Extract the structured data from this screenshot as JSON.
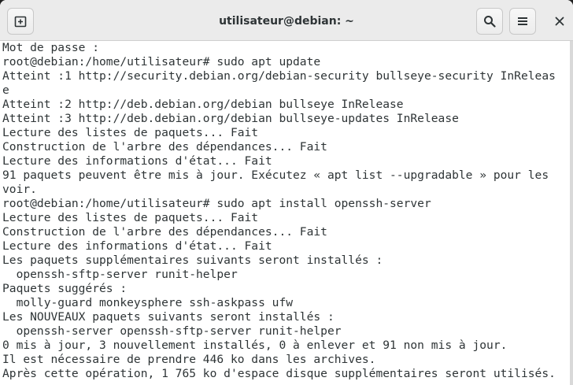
{
  "window": {
    "title": "utilisateur@debian: ~"
  },
  "toolbar": {
    "new_tab_icon": "new-tab-icon",
    "search_icon": "search-icon",
    "menu_icon": "hamburger-menu-icon",
    "close_glyph": "✕"
  },
  "terminal": {
    "lines": [
      "Mot de passe :",
      "root@debian:/home/utilisateur# sudo apt update",
      "Atteint :1 http://security.debian.org/debian-security bullseye-security InReleas",
      "e",
      "Atteint :2 http://deb.debian.org/debian bullseye InRelease",
      "Atteint :3 http://deb.debian.org/debian bullseye-updates InRelease",
      "Lecture des listes de paquets... Fait",
      "Construction de l'arbre des dépendances... Fait",
      "Lecture des informations d'état... Fait",
      "91 paquets peuvent être mis à jour. Exécutez « apt list --upgradable » pour les",
      "voir.",
      "root@debian:/home/utilisateur# sudo apt install openssh-server",
      "Lecture des listes de paquets... Fait",
      "Construction de l'arbre des dépendances... Fait",
      "Lecture des informations d'état... Fait",
      "Les paquets supplémentaires suivants seront installés :",
      "  openssh-sftp-server runit-helper",
      "Paquets suggérés :",
      "  molly-guard monkeysphere ssh-askpass ufw",
      "Les NOUVEAUX paquets suivants seront installés :",
      "  openssh-server openssh-sftp-server runit-helper",
      "0 mis à jour, 3 nouvellement installés, 0 à enlever et 91 non mis à jour.",
      "Il est nécessaire de prendre 446 ko dans les archives.",
      "Après cette opération, 1 765 ko d'espace disque supplémentaires seront utilisés."
    ]
  }
}
